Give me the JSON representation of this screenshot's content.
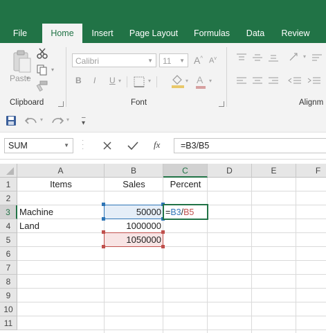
{
  "ribbon_tabs": [
    "File",
    "Home",
    "Insert",
    "Page Layout",
    "Formulas",
    "Data",
    "Review"
  ],
  "active_tab": "Home",
  "ribbon": {
    "clipboard": {
      "paste_label": "Paste",
      "group_label": "Clipboard"
    },
    "font": {
      "font_name": "Calibri",
      "font_size": "11",
      "bold": "B",
      "italic": "I",
      "underline": "U",
      "grow": "A",
      "shrink": "A",
      "group_label": "Font"
    },
    "alignment": {
      "group_label": "Alignm"
    }
  },
  "formula_bar": {
    "name_box": "SUM",
    "fx": "fx",
    "formula": "=B3/B5"
  },
  "sheet": {
    "columns": [
      "A",
      "B",
      "C",
      "D",
      "E",
      "F"
    ],
    "rows": [
      "1",
      "2",
      "3",
      "4",
      "5",
      "6",
      "7",
      "8",
      "9",
      "10",
      "11"
    ],
    "cells": {
      "A1": "Items",
      "B1": "Sales",
      "C1": "Percent",
      "A3": "Machine",
      "B3": "50000",
      "A4": "Land",
      "B4": "1000000",
      "B5": "1050000"
    },
    "editing_cell": {
      "prefix": "=",
      "ref1": "B3",
      "op": "/",
      "ref2": "B5"
    }
  },
  "colors": {
    "brand": "#217346",
    "ref1": "#2e75b6",
    "ref2": "#c0504d"
  }
}
